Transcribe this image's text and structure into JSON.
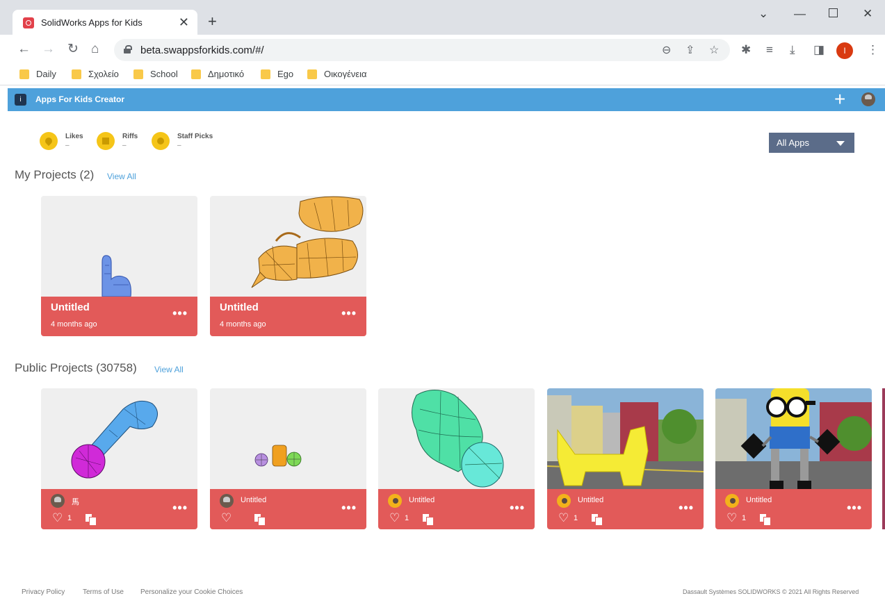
{
  "browser": {
    "tab_title": "SolidWorks Apps for Kids",
    "url": "beta.swappsforkids.com/#/",
    "profile_initial": "I",
    "bookmarks": [
      "Daily",
      "Σχολείο",
      "School",
      "Δημοτικό",
      "Ego",
      "Οικογένεια"
    ]
  },
  "app": {
    "title": "Apps For Kids Creator",
    "stats": [
      {
        "label": "Likes",
        "value": "–"
      },
      {
        "label": "Riffs",
        "value": "–"
      },
      {
        "label": "Staff Picks",
        "value": "–"
      }
    ],
    "filter": "All Apps"
  },
  "my_projects": {
    "title": "My Projects (2)",
    "view_all": "View All",
    "items": [
      {
        "title": "Untitled",
        "date": "4 months ago"
      },
      {
        "title": "Untitled",
        "date": "4 months ago"
      }
    ]
  },
  "public_projects": {
    "title": "Public Projects (30758)",
    "view_all": "View All",
    "items": [
      {
        "title": "馬",
        "likes": "1"
      },
      {
        "title": "Untitled",
        "likes": ""
      },
      {
        "title": "Untitled",
        "likes": "1"
      },
      {
        "title": "Untitled",
        "likes": "1"
      },
      {
        "title": "Untitled",
        "likes": "1"
      }
    ]
  },
  "footer": {
    "links": [
      "Privacy Policy",
      "Terms of Use",
      "Personalize your Cookie Choices"
    ],
    "copyright": "Dassault Systèmes SOLIDWORKS © 2021 All Rights Reserved"
  },
  "colors": {
    "appbar": "#4ea1db",
    "card_footer": "#e25a59",
    "stat_badge": "#f5c518",
    "dropdown": "#5b6c89"
  }
}
